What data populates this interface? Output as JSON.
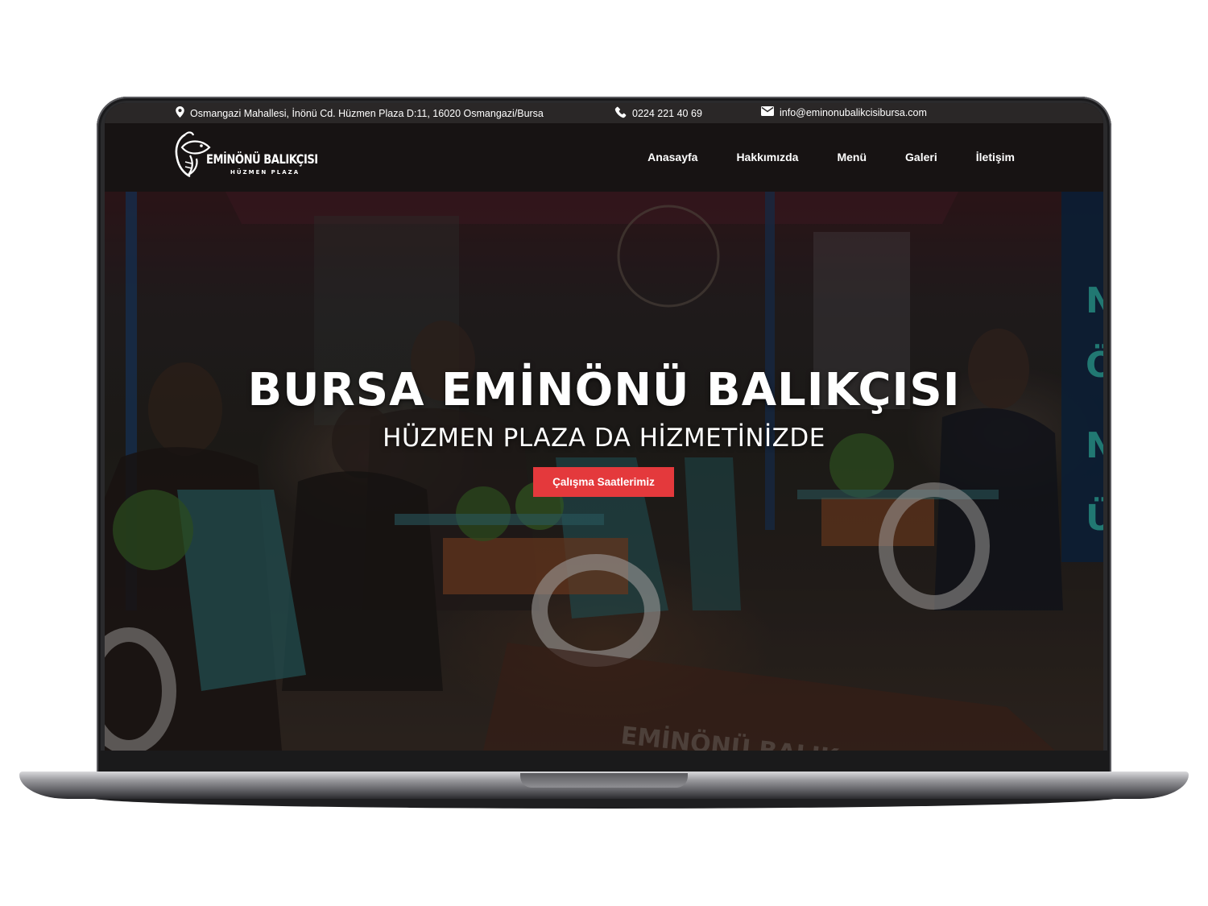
{
  "topbar": {
    "address": "Osmangazi Mahallesi, İnönü Cd. Hüzmen Plaza D:11, 16020 Osmangazi/Bursa",
    "phone": "0224 221 40 69",
    "email": "info@eminonubalikcisibursa.com"
  },
  "logo": {
    "name": "EMİNÖNÜ BALIKÇISI",
    "subtitle": "HÜZMEN PLAZA"
  },
  "nav": {
    "items": [
      "Anasayfa",
      "Hakkımızda",
      "Menü",
      "Galeri",
      "İletişim"
    ]
  },
  "hero": {
    "title": "BURSA EMİNÖNÜ BALIKÇISI",
    "subtitle": "HÜZMEN PLAZA DA HİZMETİNİZDE",
    "button_label": "Çalışma Saatlerimiz"
  },
  "colors": {
    "accent": "#e4393c",
    "topbar_bg": "#2a2727",
    "navbar_bg": "#171313"
  }
}
